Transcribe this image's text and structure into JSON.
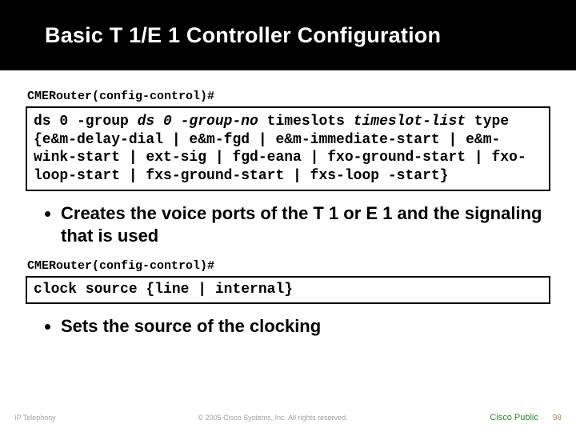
{
  "header": {
    "title": "Basic T 1/E 1 Controller Configuration"
  },
  "prompt1": "CMERouter(config-control)#",
  "code1": {
    "cmd_prefix": "ds 0 -group ",
    "cmd_param": "ds 0 -group-no",
    "cmd_mid": " timeslots ",
    "cmd_param2": "timeslot-list",
    "cmd_tail": " type {e&m-delay-dial | e&m-fgd | e&m-immediate-start | e&m-wink-start | ext-sig | fgd-eana | fxo-ground-start | fxo-loop-start | fxs-ground-start | fxs-loop -start}"
  },
  "bullet1": "Creates the voice ports of the T 1 or E 1 and the signaling that is used",
  "prompt2": "CMERouter(config-control)#",
  "code2": "clock source {line | internal}",
  "bullet2": "Sets the source of the clocking",
  "footer": {
    "left": "IP Telephony",
    "mid": "© 2005 Cisco Systems, Inc. All rights reserved.",
    "pub": "Cisco Public",
    "num": "98"
  }
}
